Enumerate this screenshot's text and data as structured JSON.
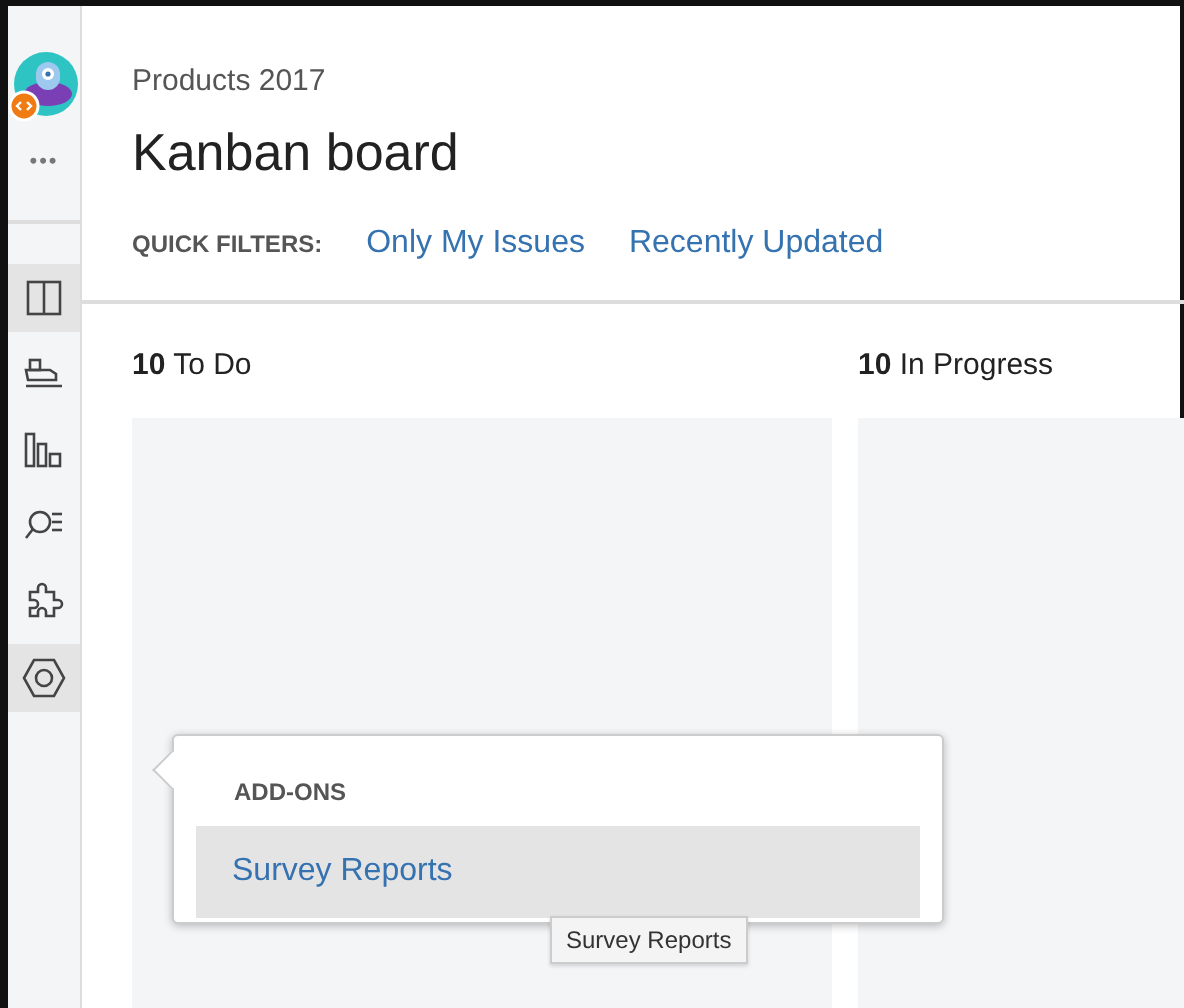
{
  "sidebar": {
    "more": "•••",
    "items": [
      {
        "selected": true
      },
      {
        "selected": false
      },
      {
        "selected": false
      },
      {
        "selected": false
      },
      {
        "selected": false
      },
      {
        "selected": true
      }
    ]
  },
  "header": {
    "breadcrumb": "Products 2017",
    "title": "Kanban board",
    "quick_filters_label": "QUICK FILTERS:",
    "quick_filters": [
      "Only My Issues",
      "Recently Updated"
    ]
  },
  "columns": [
    {
      "count": "10",
      "name": "To Do"
    },
    {
      "count": "10",
      "name": "In Progress"
    }
  ],
  "popup": {
    "heading": "ADD-ONS",
    "items": [
      {
        "label": "Survey Reports",
        "selected": true
      }
    ]
  },
  "tooltip": "Survey Reports"
}
